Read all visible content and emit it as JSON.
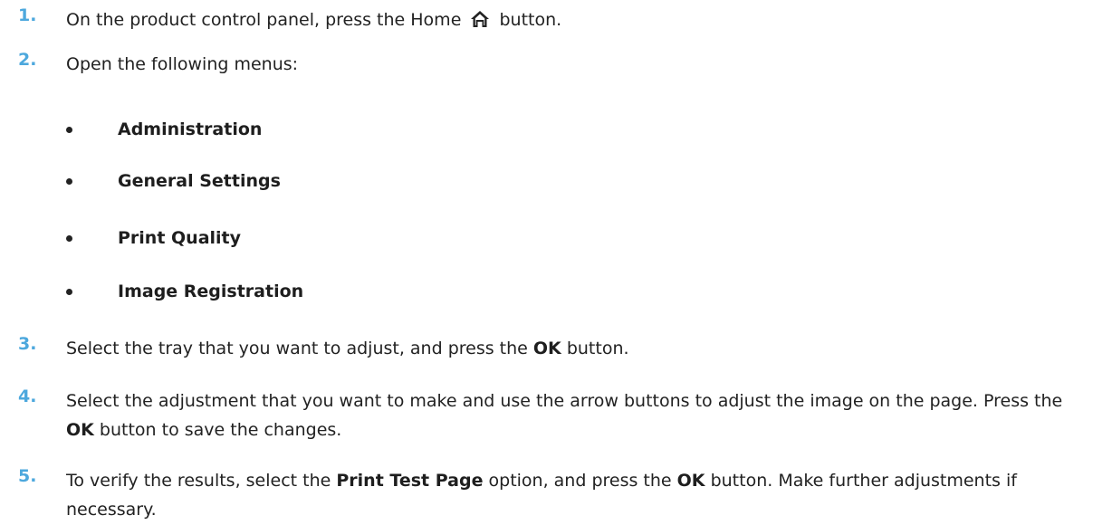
{
  "steps": [
    {
      "num": "1.",
      "parts": [
        "On the product control panel, press the Home ",
        " button."
      ],
      "icon": "home-icon"
    },
    {
      "num": "2.",
      "text": "Open the following menus:"
    },
    {
      "num": "3.",
      "a": "Select the tray that you want to adjust, and press the ",
      "b": "OK",
      "c": " button."
    },
    {
      "num": "4.",
      "a": "Select the adjustment that you want to make and use the arrow buttons to adjust the image on the page. Press the ",
      "b": "OK",
      "c": " button to save the changes."
    },
    {
      "num": "5.",
      "a": "To verify the results, select the ",
      "b": "Print Test Page",
      "c": " option, and press the ",
      "d": "OK",
      "e": " button. Make further adjustments if necessary."
    }
  ],
  "menus": [
    "Administration",
    "General Settings",
    "Print Quality",
    "Image Registration"
  ],
  "colors": {
    "step_number": "#4da8dd"
  }
}
